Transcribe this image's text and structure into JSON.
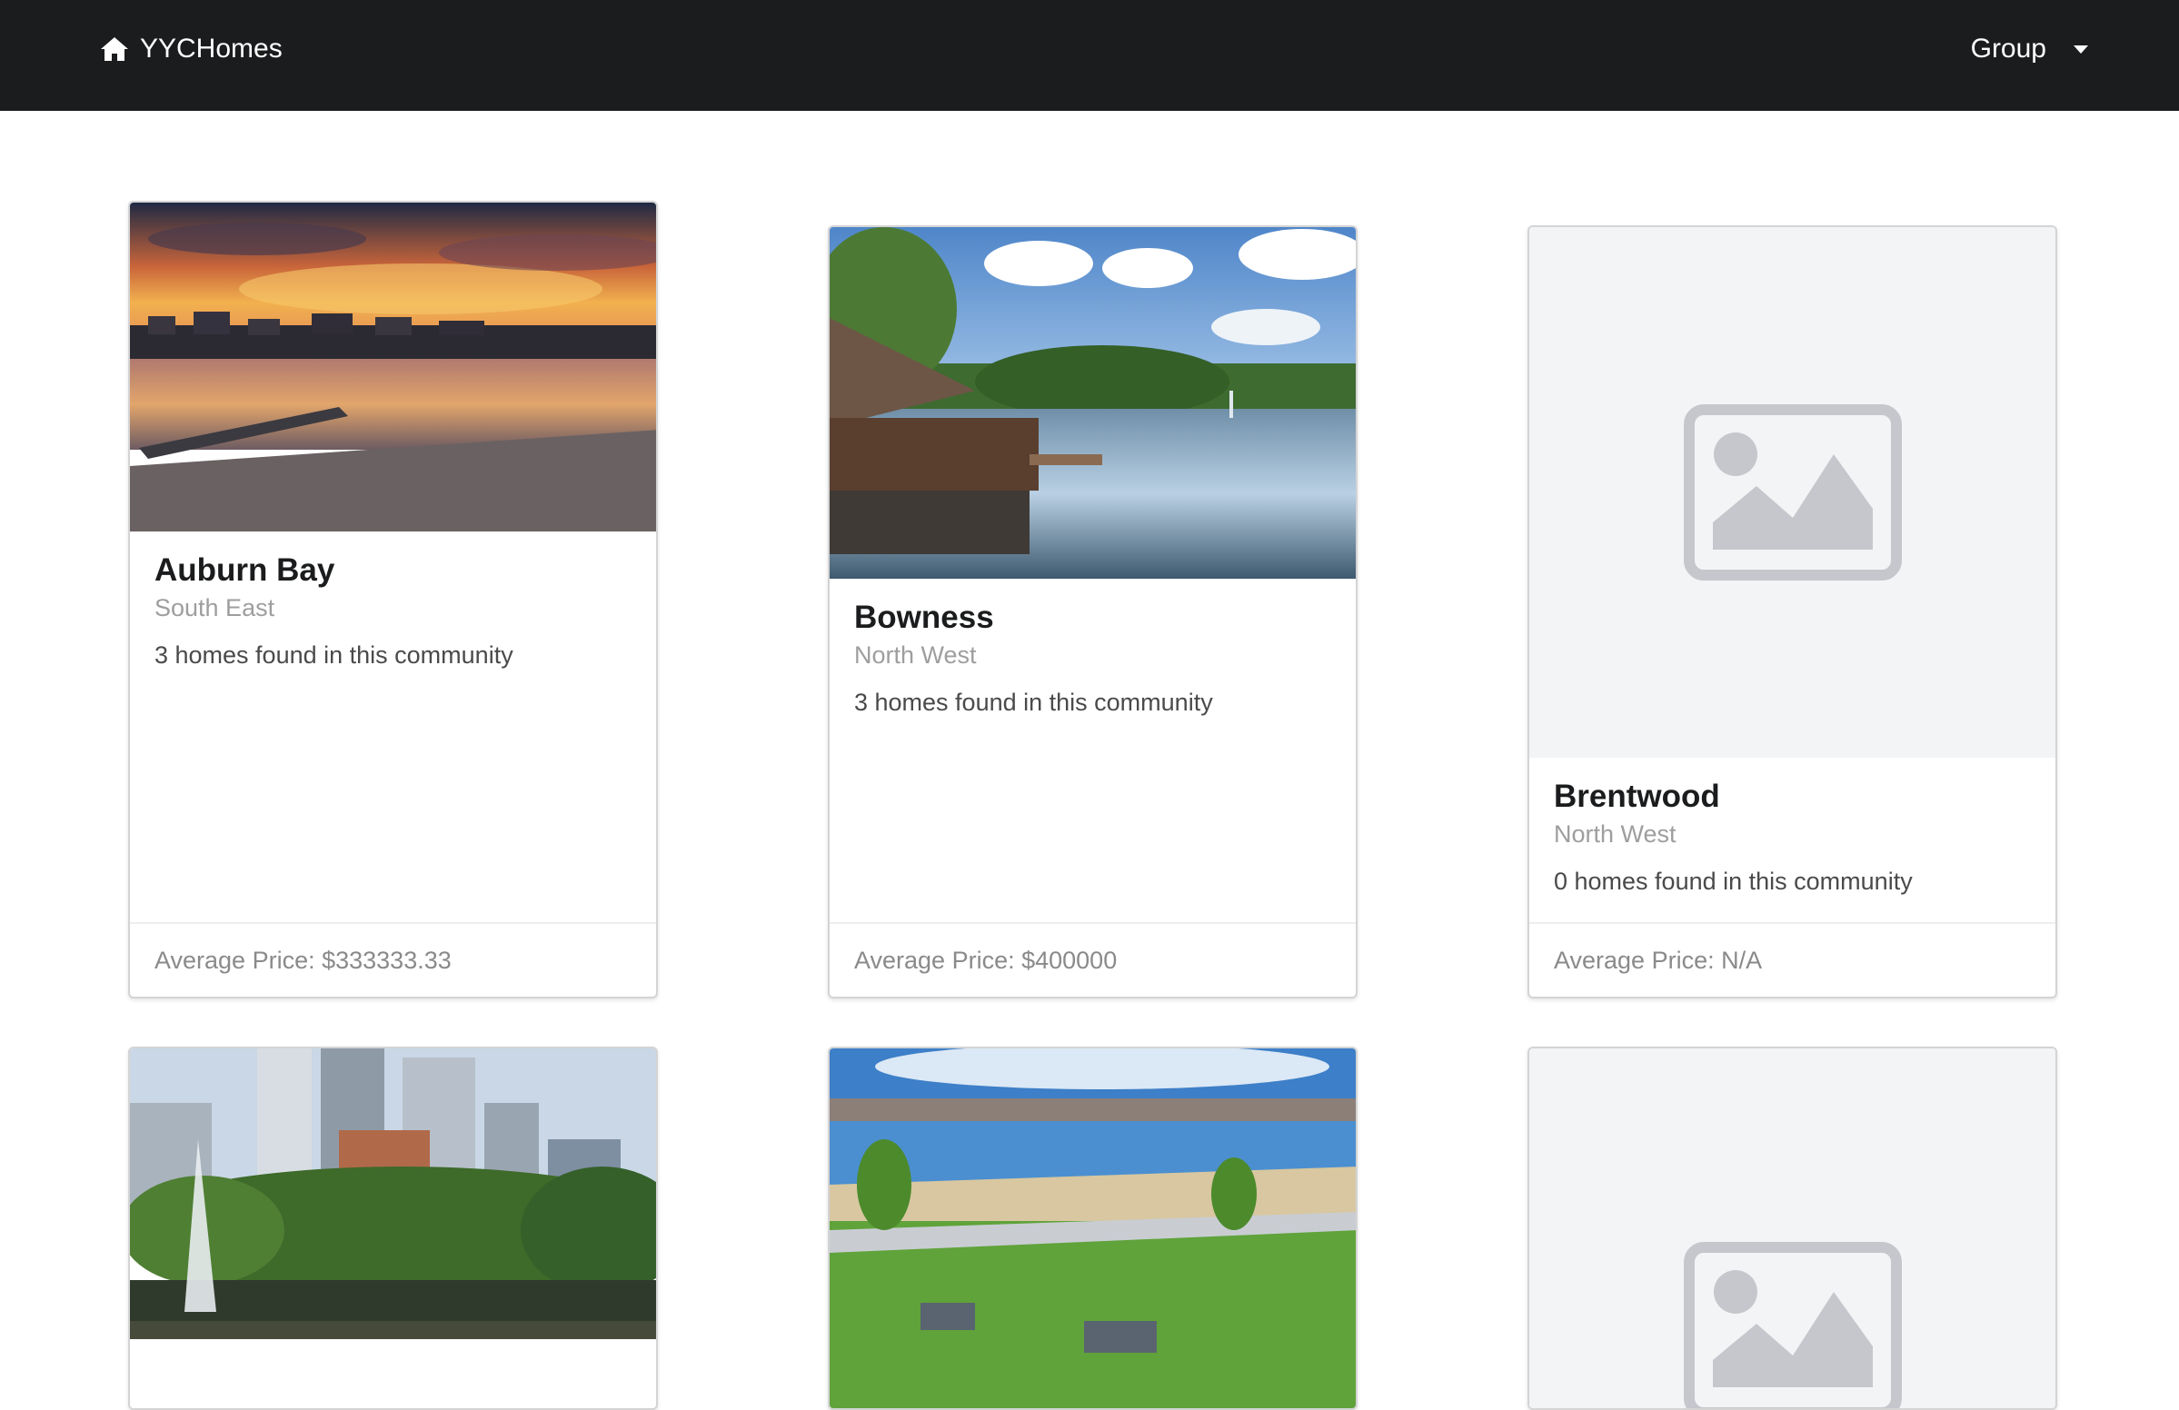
{
  "navbar": {
    "brand_label": "YYCHomes",
    "brand_icon": "home-icon",
    "group_label": "Group",
    "background": "#1b1c1d"
  },
  "communities": [
    {
      "name": "Auburn Bay",
      "quadrant": "South East",
      "homes_text": "3 homes found in this community",
      "avg_price": "Average Price: $333333.33",
      "image": "lake-sunset-photo"
    },
    {
      "name": "Bowness",
      "quadrant": "North West",
      "homes_text": "3 homes found in this community",
      "avg_price": "Average Price: $400000",
      "image": "lagoon-pavilion-photo"
    },
    {
      "name": "Brentwood",
      "quadrant": "North West",
      "homes_text": "0 homes found in this community",
      "avg_price": "Average Price: N/A",
      "image": "image-placeholder-icon"
    },
    {
      "image": "downtown-fountain-photo"
    },
    {
      "image": "lake-park-photo"
    },
    {
      "image": "image-placeholder-icon"
    }
  ]
}
